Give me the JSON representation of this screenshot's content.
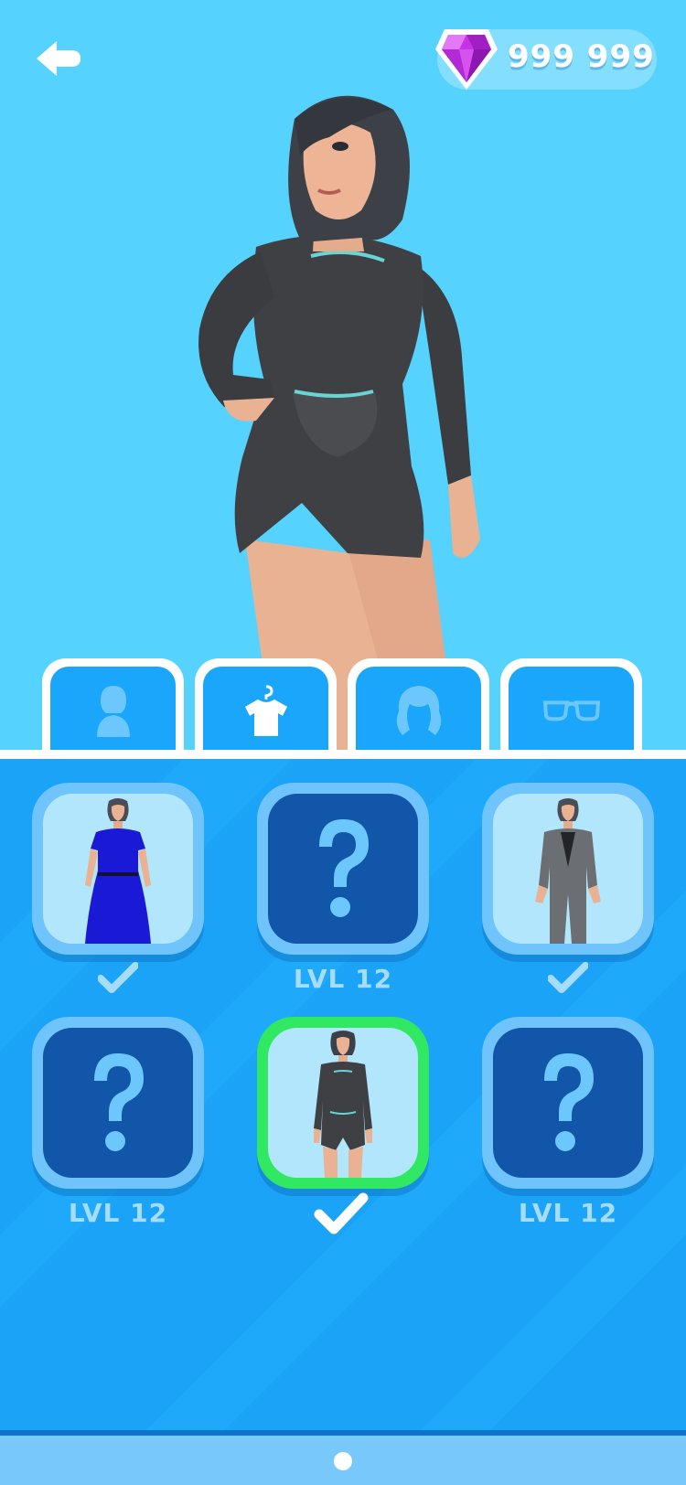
{
  "header": {
    "back_icon": "back-arrow-icon",
    "currency": {
      "icon": "gem-icon",
      "amount": "999 999"
    }
  },
  "tabs": [
    {
      "name": "avatar",
      "icon": "avatar-icon"
    },
    {
      "name": "outfit",
      "icon": "shirt-hanger-icon",
      "active": true
    },
    {
      "name": "hair",
      "icon": "hair-icon"
    },
    {
      "name": "glasses",
      "icon": "glasses-icon"
    }
  ],
  "items": [
    {
      "state": "unlocked",
      "preview": "blue-dress",
      "caption": ""
    },
    {
      "state": "locked",
      "preview": "question-mark",
      "caption": "LVL 12"
    },
    {
      "state": "unlocked",
      "preview": "grey-suit",
      "caption": ""
    },
    {
      "state": "locked",
      "preview": "question-mark",
      "caption": "LVL 12"
    },
    {
      "state": "selected",
      "preview": "black-wetsuit",
      "caption": ""
    },
    {
      "state": "locked",
      "preview": "question-mark",
      "caption": "LVL 12"
    }
  ],
  "pagination": {
    "pages": 1,
    "current": 1
  },
  "colors": {
    "sky": "#55d2fd",
    "panel": "#1aa3f7",
    "locked_tile": "#1156a8",
    "selected_border": "#31e863",
    "gem": "#c832e6"
  }
}
